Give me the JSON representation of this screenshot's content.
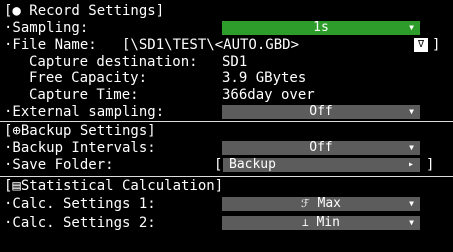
{
  "record": {
    "header": "[● Record Settings]",
    "sampling_label": "·Sampling:",
    "sampling_value": "1s",
    "filename_label": "·File Name:",
    "filename_value": "[\\SD1\\TEST\\<AUTO.GBD>",
    "filename_button": "∇",
    "filename_bracket": "]",
    "capture_dest_label": "Capture destination:",
    "capture_dest_value": "SD1",
    "free_capacity_label": "Free Capacity:",
    "free_capacity_value": "3.9 GBytes",
    "capture_time_label": "Capture Time:",
    "capture_time_value": "366day over",
    "external_sampling_label": "·External sampling:",
    "external_sampling_value": "Off"
  },
  "backup": {
    "header": "[⊕Backup Settings]",
    "intervals_label": "·Backup Intervals:",
    "intervals_value": "Off",
    "folder_label": "·Save Folder:",
    "folder_open_bracket": "[",
    "folder_value": "Backup",
    "folder_close_bracket": "]"
  },
  "stats": {
    "header": "[▤Statistical Calculation]",
    "calc1_label": "·Calc. Settings 1:",
    "calc1_icon": "ℱ",
    "calc1_value": "Max",
    "calc2_label": "·Calc. Settings 2:",
    "calc2_icon": "⊥",
    "calc2_value": "Min"
  },
  "icons": {
    "dropdown_arrow": "▼",
    "folder_arrow": "▸"
  },
  "colors": {
    "selected": "#2e9c2a",
    "dropdown": "#5c5c5c",
    "background": "#000000"
  }
}
